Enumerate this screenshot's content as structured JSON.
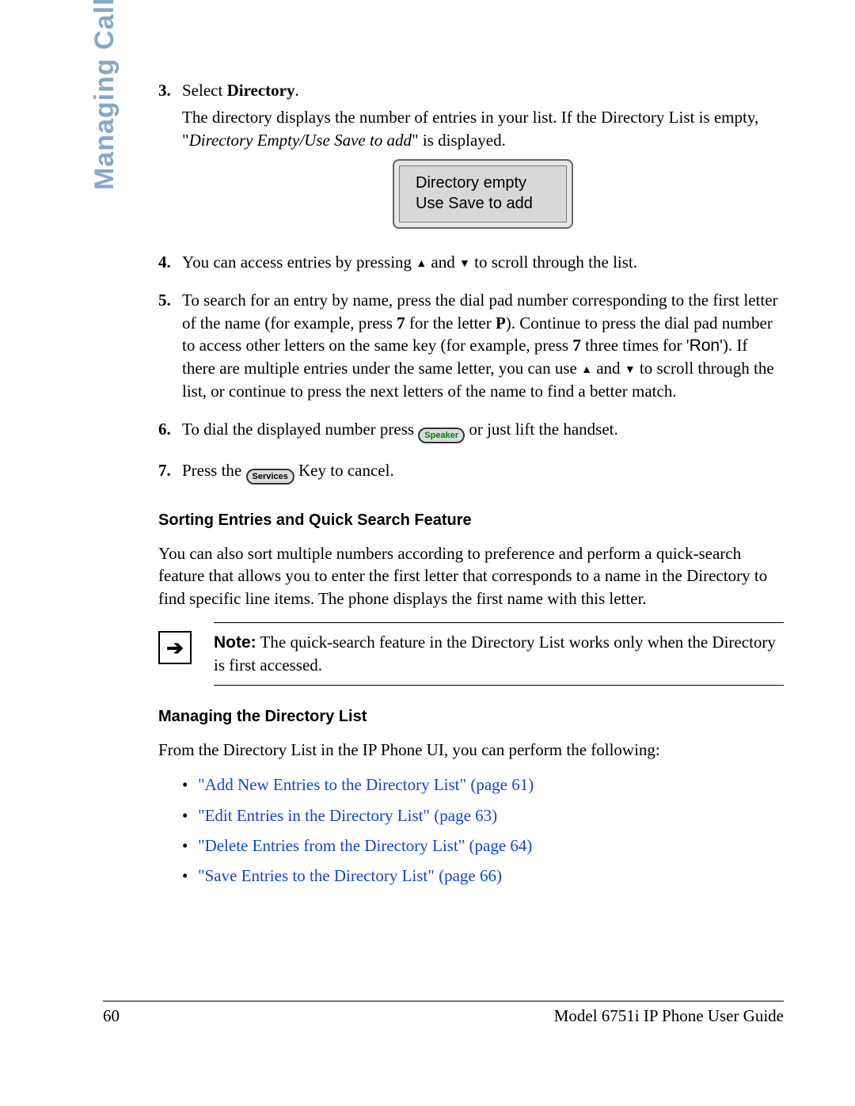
{
  "side_tab": "Managing Calls",
  "steps": {
    "s3": {
      "num": "3.",
      "lead": "Select ",
      "bold": "Directory",
      "trail": ".",
      "p2a": "The directory displays the number of entries in your list. If the Directory List is empty, \"",
      "p2i": "Directory Empty/Use Save to add",
      "p2b": "\" is displayed."
    },
    "s4": {
      "num": "4.",
      "a": "You can access entries by pressing ",
      "b": " and ",
      "c": " to scroll through the list."
    },
    "s5": {
      "num": "5.",
      "a": "To search for an entry by name, press the dial pad number corresponding to the first letter of the name (for example, press ",
      "seven1": "7",
      "b": " for the letter ",
      "P": "P",
      "c": "). Continue to press the dial pad number to access other letters on the same key (for example, press ",
      "seven2": "7",
      "d": " three times for '",
      "ron": "Ron",
      "e": "'). If there are multiple entries under the same letter, you can use ",
      "f": " and ",
      "g": " to scroll through the list, or continue to press the next letters of the name to find a better match."
    },
    "s6": {
      "num": "6.",
      "a": "To dial the displayed number press ",
      "speaker": "Speaker",
      "b": " or just lift the handset."
    },
    "s7": {
      "num": "7.",
      "a": "Press the ",
      "services": "Services",
      "b": " Key to cancel."
    }
  },
  "lcd": {
    "l1": "Directory empty",
    "l2": "Use Save to add"
  },
  "section1": {
    "title": "Sorting Entries and Quick Search Feature",
    "body": "You can also sort multiple numbers according to preference and perform a quick-search feature that allows you to enter the first letter that corresponds to a name in the Directory to find specific line items. The phone displays the first name with this letter."
  },
  "note": {
    "lead": "Note:",
    "text": " The quick-search feature in the Directory List works only when the Directory is first accessed."
  },
  "section2": {
    "title": "Managing the Directory List",
    "intro": "From the Directory List in the IP Phone UI, you can perform the following:",
    "items": [
      {
        "link": "\"Add New Entries to the Directory List\"",
        "page": " (page 61)"
      },
      {
        "link": "\"Edit Entries in the Directory List\"",
        "page": " (page 63)"
      },
      {
        "link": "\"Delete Entries from the Directory List\"",
        "page": " (page 64)"
      },
      {
        "link": "\"Save Entries to the Directory List\"",
        "page": " (page 66)"
      }
    ]
  },
  "footer": {
    "page": "60",
    "title": "Model 6751i IP Phone User Guide"
  }
}
